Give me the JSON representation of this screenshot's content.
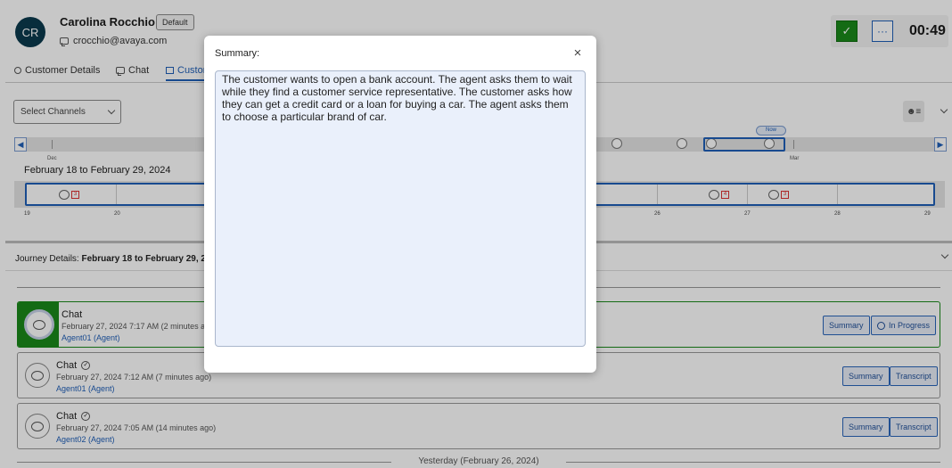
{
  "customer": {
    "initials": "CR",
    "name": "Carolina Rocchio",
    "badge": "Default",
    "email": "crocchio@avaya.com"
  },
  "call": {
    "timer": "00:49",
    "check_symbol": "✓",
    "more_symbol": "···"
  },
  "tabs": [
    {
      "label": "Customer Details"
    },
    {
      "label": "Chat"
    },
    {
      "label": "Customer Journey"
    }
  ],
  "timeline": {
    "select_placeholder": "Select Channels",
    "months": [
      "Dec",
      "Mar"
    ],
    "now_label": "Now",
    "range_label": "February 18 to February 29, 2024",
    "days": [
      "19",
      "20",
      "21",
      "26",
      "27",
      "28",
      "29"
    ],
    "counts": [
      "3",
      "4",
      "3"
    ]
  },
  "journey": {
    "prefix": "Journey Details:",
    "range": "February 18 to February 29, 2024"
  },
  "interactions": [
    {
      "title": "Chat",
      "date": "February 27, 2024 7:17 AM (2 minutes ago)",
      "agent": "Agent01 (Agent)",
      "btn1": "Summary",
      "btn2": "In Progress"
    },
    {
      "title": "Chat",
      "date": "February 27, 2024 7:12 AM (7 minutes ago)",
      "agent": "Agent01 (Agent)",
      "btn1": "Summary",
      "btn2": "Transcript"
    },
    {
      "title": "Chat",
      "date": "February 27, 2024 7:05 AM (14 minutes ago)",
      "agent": "Agent02 (Agent)",
      "btn1": "Summary",
      "btn2": "Transcript"
    }
  ],
  "yesterday": "Yesterday (February 26, 2024)",
  "modal": {
    "title": "Summary:",
    "close": "×",
    "summary": "The customer wants to open a bank account. The agent asks them to wait while they find a customer service representative. The customer asks how they can get a credit card or a loan for buying a car. The agent asks them to choose a particular brand of car."
  }
}
